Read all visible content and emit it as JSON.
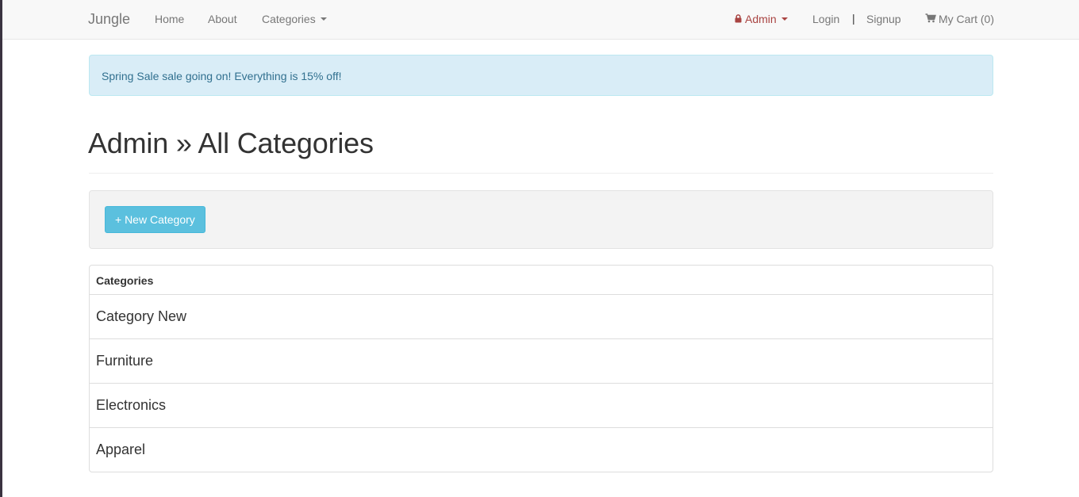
{
  "navbar": {
    "brand": "Jungle",
    "links": [
      {
        "label": "Home"
      },
      {
        "label": "About"
      },
      {
        "label": "Categories"
      }
    ],
    "admin_label": "Admin",
    "login_label": "Login",
    "separator": "|",
    "signup_label": "Signup",
    "cart_label": "My Cart (0)",
    "icons": {
      "lock": "lock-icon",
      "cart": "shopping-cart-icon",
      "dropdown": "caret-down-icon"
    }
  },
  "alert": {
    "message": "Spring Sale sale going on! Everything is 15% off!"
  },
  "page": {
    "title": "Admin » All Categories"
  },
  "toolbar": {
    "new_category_label": "+ New Category"
  },
  "categories_table": {
    "header": "Categories",
    "rows": [
      {
        "name": "Category New"
      },
      {
        "name": "Furniture"
      },
      {
        "name": "Electronics"
      },
      {
        "name": "Apparel"
      }
    ]
  },
  "colors": {
    "navbar_bg": "#f8f8f8",
    "alert_bg": "#d9edf7",
    "alert_text": "#31708f",
    "admin_red": "#a94442",
    "button_info": "#5bc0de"
  }
}
